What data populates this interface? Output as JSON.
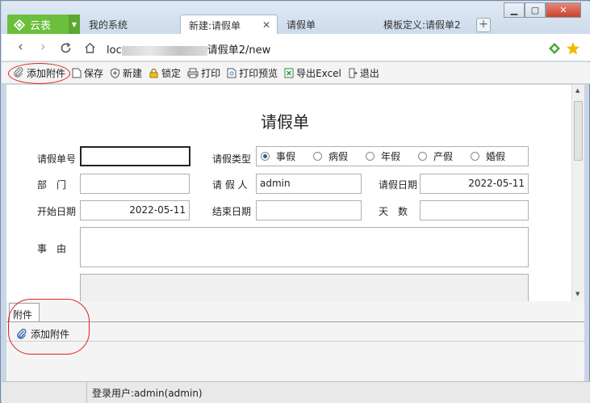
{
  "tabs": {
    "logo_label": "云表",
    "items": [
      {
        "label": "我的系统"
      },
      {
        "label": "新建:请假单",
        "active": true
      },
      {
        "label": "请假单"
      },
      {
        "label": "模板定义:请假单2"
      }
    ],
    "new_tab_symbol": "+"
  },
  "window": {
    "minimize": "▁",
    "maximize": "▢",
    "close": "✕"
  },
  "address": {
    "url_prefix": "loc",
    "url_suffix": "请假单2/new"
  },
  "toolbar": {
    "add_attachment": "添加附件",
    "save": "保存",
    "new": "新建",
    "lock": "锁定",
    "print": "打印",
    "print_preview": "打印预览",
    "export_excel": "导出Excel",
    "exit": "退出"
  },
  "form": {
    "title": "请假单",
    "labels": {
      "number": "请假单号",
      "type": "请假类型",
      "dept": "部　门",
      "applicant": "请 假 人",
      "apply_date": "请假日期",
      "start_date": "开始日期",
      "end_date": "结束日期",
      "days": "天　数",
      "reason": "事　由"
    },
    "values": {
      "number": "",
      "dept": "",
      "applicant": "admin",
      "apply_date": "2022-05-11",
      "start_date": "2022-05-11",
      "end_date": "",
      "days": "",
      "reason": ""
    },
    "leave_types": [
      "事假",
      "病假",
      "年假",
      "产假",
      "婚假"
    ],
    "selected_leave_type": "事假"
  },
  "attachments": {
    "tab_label": "附件",
    "add_label": "添加附件"
  },
  "status": {
    "user": "登录用户:admin(admin)"
  },
  "colors": {
    "brand": "#6cbf3c",
    "highlight_ring": "#e02020",
    "radio_selected": "#2a5aa8"
  }
}
